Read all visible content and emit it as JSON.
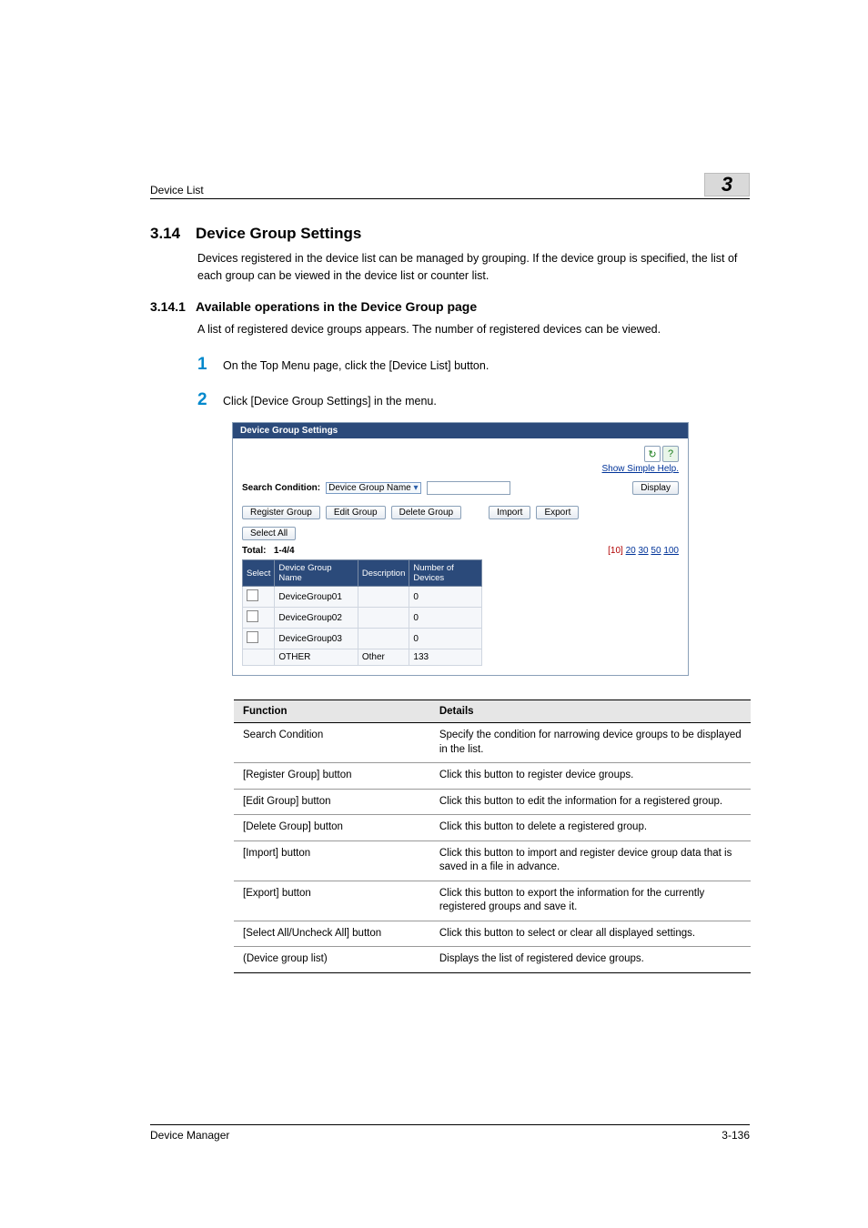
{
  "header": {
    "left": "Device List",
    "chapter": "3"
  },
  "section": {
    "num": "3.14",
    "title": "Device Group Settings"
  },
  "section_body": "Devices registered in the device list can be managed by grouping. If the device group is specified, the list of each group can be viewed in the device list or counter list.",
  "subsection": {
    "num": "3.14.1",
    "title": "Available operations in the Device Group page"
  },
  "subsection_body": "A list of registered device groups appears. The number of registered devices can be viewed.",
  "steps": [
    {
      "n": "1",
      "t": "On the Top Menu page, click the [Device List] button."
    },
    {
      "n": "2",
      "t": "Click [Device Group Settings] in the menu."
    }
  ],
  "screenshot": {
    "title": "Device Group Settings",
    "help_link": "Show Simple Help.",
    "search_label": "Search Condition:",
    "search_select": "Device Group Name",
    "display_btn": "Display",
    "btns": {
      "register": "Register Group",
      "edit": "Edit Group",
      "delete": "Delete Group",
      "import": "Import",
      "export": "Export",
      "select_all": "Select All"
    },
    "total_label": "Total:",
    "total_range": "1-4/4",
    "paging_current": "[10]",
    "paging_links": [
      "20",
      "30",
      "50",
      "100"
    ],
    "cols": {
      "select": "Select",
      "name": "Device Group Name",
      "desc": "Description",
      "num": "Number of Devices"
    },
    "rows": [
      {
        "check": true,
        "name": "DeviceGroup01",
        "desc": "",
        "num": "0"
      },
      {
        "check": true,
        "name": "DeviceGroup02",
        "desc": "",
        "num": "0"
      },
      {
        "check": true,
        "name": "DeviceGroup03",
        "desc": "",
        "num": "0"
      },
      {
        "check": false,
        "name": "OTHER",
        "desc": "Other",
        "num": "133"
      }
    ]
  },
  "functable": {
    "h1": "Function",
    "h2": "Details",
    "rows": [
      {
        "f": "Search Condition",
        "d": "Specify the condition for narrowing device groups to be displayed in the list."
      },
      {
        "f": "[Register Group] button",
        "d": "Click this button to register device groups."
      },
      {
        "f": "[Edit Group] button",
        "d": "Click this button to edit the information for a registered group."
      },
      {
        "f": "[Delete Group] button",
        "d": "Click this button to delete a registered group."
      },
      {
        "f": "[Import] button",
        "d": "Click this button to import and register device group data that is saved in a file in advance."
      },
      {
        "f": "[Export] button",
        "d": "Click this button to export the information for the currently registered groups and save it."
      },
      {
        "f": "[Select All/Uncheck All] button",
        "d": "Click this button to select or clear all displayed settings."
      },
      {
        "f": "(Device group list)",
        "d": "Displays the list of registered device groups."
      }
    ]
  },
  "footer": {
    "left": "Device Manager",
    "right": "3-136"
  }
}
